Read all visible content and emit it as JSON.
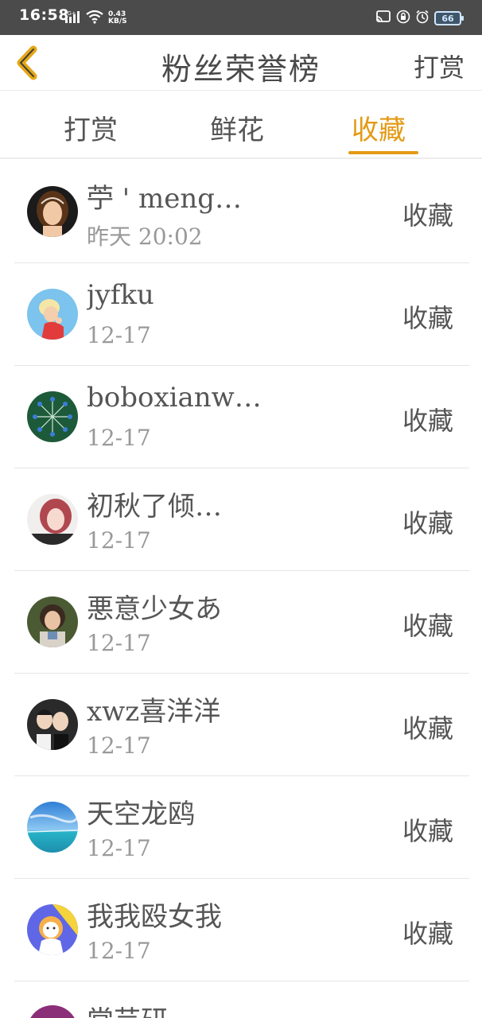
{
  "status_bar": {
    "time": "16:58",
    "network": "4G+",
    "speed": "0.43",
    "speed_unit": "KB/S",
    "battery": "66"
  },
  "header": {
    "title": "粉丝荣誉榜",
    "right_action": "打赏"
  },
  "tabs": [
    {
      "label": "打赏",
      "active": false
    },
    {
      "label": "鲜花",
      "active": false
    },
    {
      "label": "收藏",
      "active": true
    }
  ],
  "accent_color": "#e39a14",
  "list": [
    {
      "name": "苧 ' meng…",
      "date": "昨天 20:02",
      "action": "收藏"
    },
    {
      "name": "jyfku",
      "date": "12-17",
      "action": "收藏"
    },
    {
      "name": "boboxianw…",
      "date": "12-17",
      "action": "收藏"
    },
    {
      "name": "初秋了倾…",
      "date": "12-17",
      "action": "收藏"
    },
    {
      "name": "悪意少女あ",
      "date": "12-17",
      "action": "收藏"
    },
    {
      "name": "xwz喜洋洋",
      "date": "12-17",
      "action": "收藏"
    },
    {
      "name": "天空龙鸥",
      "date": "12-17",
      "action": "收藏"
    },
    {
      "name": "我我殴女我",
      "date": "12-17",
      "action": "收藏"
    },
    {
      "name": "常芸研",
      "date": "",
      "action": ""
    }
  ]
}
